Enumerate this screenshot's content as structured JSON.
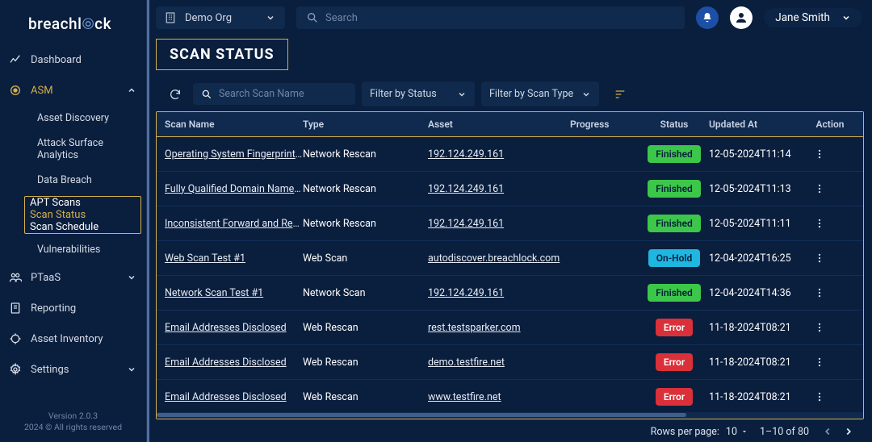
{
  "brand": {
    "pre": "breachl",
    "post": "ck"
  },
  "topbar": {
    "org": "Demo Org",
    "search_placeholder": "Search",
    "user_name": "Jane Smith"
  },
  "sidebar": {
    "items": {
      "dashboard": "Dashboard",
      "asm": "ASM",
      "ptaas": "PTaaS",
      "reporting": "Reporting",
      "asset_inventory": "Asset Inventory",
      "settings": "Settings"
    },
    "asm_sub": {
      "asset_discovery": "Asset Discovery",
      "attack_surface": "Attack Surface Analytics",
      "data_breach": "Data Breach",
      "apt_scans": "APT Scans",
      "scan_status": "Scan Status",
      "scan_schedule": "Scan Schedule",
      "vulnerabilities": "Vulnerabilities"
    }
  },
  "page_title": "SCAN STATUS",
  "filters": {
    "search_placeholder": "Search Scan Name",
    "status": "Filter by Status",
    "scan_type": "Filter by Scan Type"
  },
  "columns": {
    "name": "Scan Name",
    "type": "Type",
    "asset": "Asset",
    "progress": "Progress",
    "status": "Status",
    "updated": "Updated At",
    "action": "Action"
  },
  "rows": [
    {
      "name": "Operating System Fingerprinted",
      "type": "Network Rescan",
      "asset": "192.124.249.161",
      "status": "Finished",
      "updated": "12-05-2024T11:14"
    },
    {
      "name": "Fully Qualified Domain Name (FQDN)",
      "type": "Network Rescan",
      "asset": "192.124.249.161",
      "status": "Finished",
      "updated": "12-05-2024T11:13"
    },
    {
      "name": "Inconsistent Forward and Reverse",
      "type": "Network Rescan",
      "asset": "192.124.249.161",
      "status": "Finished",
      "updated": "12-05-2024T11:11"
    },
    {
      "name": "Web Scan Test #1",
      "type": "Web Scan",
      "asset": "autodiscover.breachlock.com",
      "status": "On-Hold",
      "updated": "12-04-2024T16:25"
    },
    {
      "name": "Network Scan Test #1",
      "type": "Network Scan",
      "asset": "192.124.249.161",
      "status": "Finished",
      "updated": "12-04-2024T14:36"
    },
    {
      "name": "Email Addresses Disclosed",
      "type": "Web Rescan",
      "asset": "rest.testsparker.com",
      "status": "Error",
      "updated": "11-18-2024T08:21"
    },
    {
      "name": "Email Addresses Disclosed",
      "type": "Web Rescan",
      "asset": "demo.testfire.net",
      "status": "Error",
      "updated": "11-18-2024T08:21"
    },
    {
      "name": "Email Addresses Disclosed",
      "type": "Web Rescan",
      "asset": "www.testfire.net",
      "status": "Error",
      "updated": "11-18-2024T08:21"
    }
  ],
  "pagination": {
    "rows_label": "Rows per page:",
    "rows_value": "10",
    "range": "1–10 of 80"
  },
  "footer": {
    "version": "Version 2.0.3",
    "rights": "2024 © All rights reserved"
  }
}
